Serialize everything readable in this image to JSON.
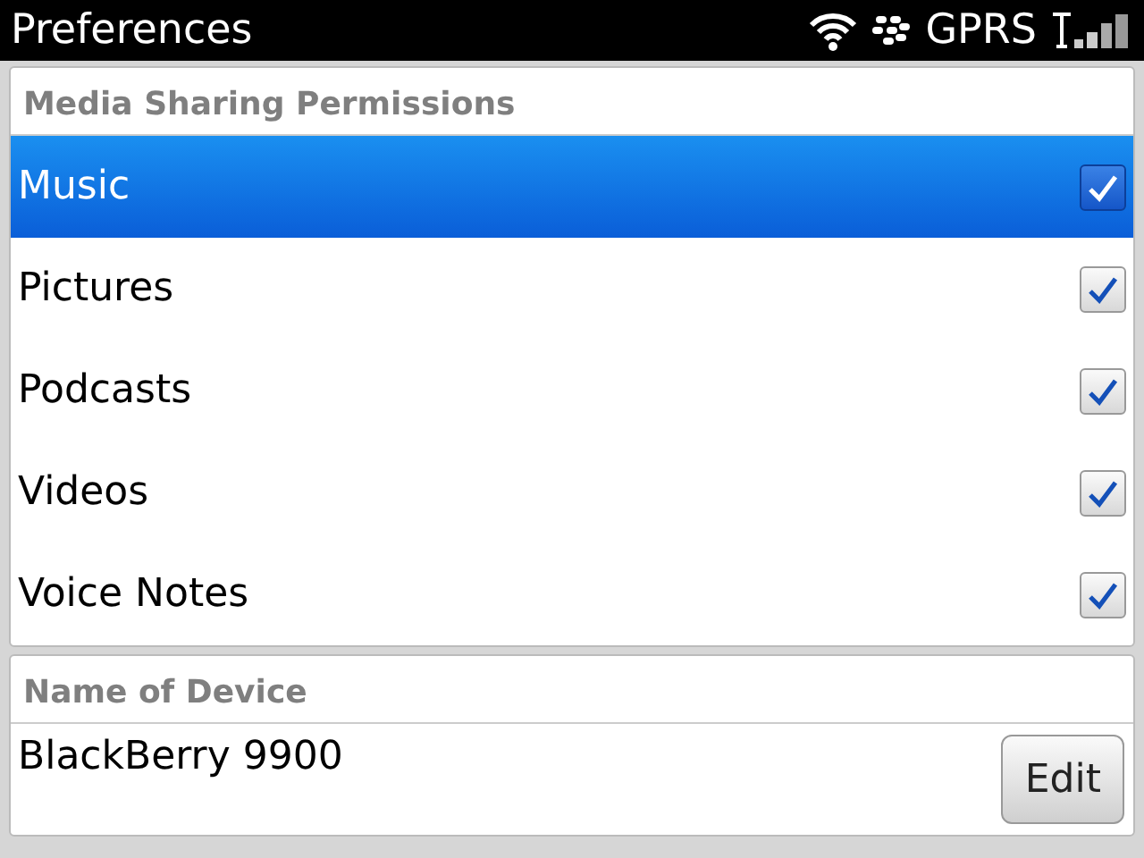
{
  "status_bar": {
    "title": "Preferences",
    "network": "GPRS"
  },
  "permissions": {
    "header": "Media Sharing Permissions",
    "items": [
      {
        "label": "Music",
        "checked": true,
        "selected": true
      },
      {
        "label": "Pictures",
        "checked": true,
        "selected": false
      },
      {
        "label": "Podcasts",
        "checked": true,
        "selected": false
      },
      {
        "label": "Videos",
        "checked": true,
        "selected": false
      },
      {
        "label": "Voice Notes",
        "checked": true,
        "selected": false
      }
    ]
  },
  "device": {
    "header": "Name of Device",
    "name": "BlackBerry 9900",
    "button": "Edit"
  }
}
